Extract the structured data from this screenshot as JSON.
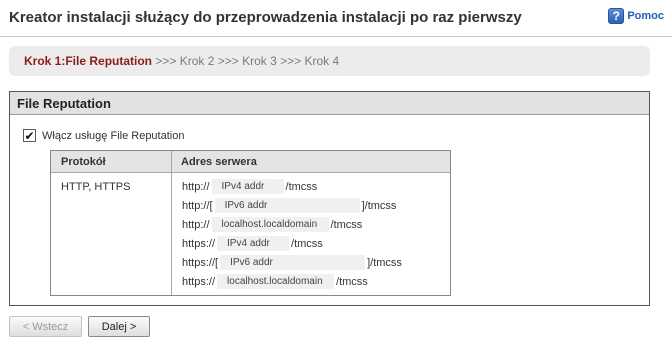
{
  "header": {
    "title": "Kreator instalacji służący do przeprowadzenia instalacji po raz pierwszy",
    "help_label": "Pomoc",
    "help_icon": "question-mark-icon"
  },
  "steps": {
    "current": "Krok 1:File Reputation",
    "rest": " >>> Krok 2 >>> Krok 3 >>> Krok 4"
  },
  "panel": {
    "title": "File Reputation",
    "enable_label": "Włącz usługę File Reputation",
    "enable_checked": true,
    "table": {
      "headers": [
        "Protokół",
        "Adres serwera"
      ],
      "protocol": "HTTP, HTTPS",
      "rows": [
        {
          "prefix": "http://",
          "field": "IPv4 addr",
          "suffix": "/tmcss"
        },
        {
          "prefix": "http://[",
          "field": "IPv6 addr",
          "suffix": "]/tmcss"
        },
        {
          "prefix": "http://",
          "field": "localhost.localdomain",
          "suffix": "/tmcss"
        },
        {
          "prefix": "https://",
          "field": "IPv4 addr",
          "suffix": "/tmcss"
        },
        {
          "prefix": "https://[",
          "field": "IPv6 addr",
          "suffix": "]/tmcss"
        },
        {
          "prefix": "https://",
          "field": "localhost.localdomain",
          "suffix": "/tmcss"
        }
      ]
    }
  },
  "buttons": {
    "back": "< Wstecz",
    "back_enabled": false,
    "next": "Dalej >"
  }
}
